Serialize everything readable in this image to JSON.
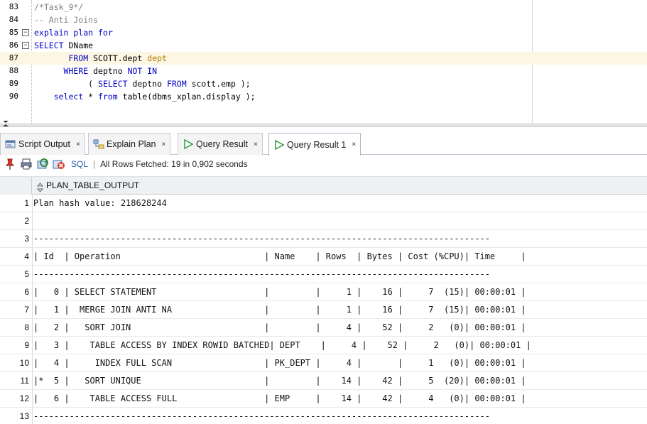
{
  "editor": {
    "lines": [
      {
        "num": "83",
        "fold": "",
        "segments": [
          {
            "t": "comment",
            "s": "/*Task_9*/"
          }
        ]
      },
      {
        "num": "84",
        "fold": "",
        "segments": [
          {
            "t": "comment",
            "s": "-- Anti Joins"
          }
        ]
      },
      {
        "num": "85",
        "fold": "⊟",
        "segments": [
          {
            "t": "keyword",
            "s": "explain plan for"
          }
        ]
      },
      {
        "num": "86",
        "fold": "⊟",
        "segments": [
          {
            "t": "keyword",
            "s": "SELECT"
          },
          {
            "t": "text",
            "s": " DName"
          }
        ]
      },
      {
        "num": "87",
        "fold": "",
        "current": true,
        "segments": [
          {
            "t": "text",
            "s": "       "
          },
          {
            "t": "keyword",
            "s": "FROM"
          },
          {
            "t": "text",
            "s": " SCOTT.dept "
          },
          {
            "t": "alias",
            "s": "dept"
          }
        ]
      },
      {
        "num": "88",
        "fold": "",
        "segments": [
          {
            "t": "text",
            "s": "      "
          },
          {
            "t": "keyword",
            "s": "WHERE"
          },
          {
            "t": "text",
            "s": " deptno "
          },
          {
            "t": "keyword",
            "s": "NOT IN"
          }
        ]
      },
      {
        "num": "89",
        "fold": "",
        "segments": [
          {
            "t": "text",
            "s": "           ( "
          },
          {
            "t": "keyword",
            "s": "SELECT"
          },
          {
            "t": "text",
            "s": " deptno "
          },
          {
            "t": "keyword",
            "s": "FROM"
          },
          {
            "t": "text",
            "s": " scott.emp );"
          }
        ]
      },
      {
        "num": "90",
        "fold": "",
        "segments": [
          {
            "t": "text",
            "s": "    "
          },
          {
            "t": "keyword",
            "s": "select"
          },
          {
            "t": "text",
            "s": " * "
          },
          {
            "t": "keyword",
            "s": "from"
          },
          {
            "t": "text",
            "s": " table(dbms_xplan.display );"
          }
        ]
      }
    ]
  },
  "tabs": [
    {
      "id": "script",
      "label": "Script Output",
      "close": "×"
    },
    {
      "id": "explain",
      "label": "Explain Plan",
      "close": "×"
    },
    {
      "id": "query",
      "label": "Query Result",
      "close": "×"
    },
    {
      "id": "query1",
      "label": "Query Result 1",
      "close": "×",
      "active": true
    }
  ],
  "toolbar": {
    "sql_label": "SQL",
    "separator": "|",
    "status": "All Rows Fetched: 19 in 0,902 seconds"
  },
  "grid": {
    "column": "PLAN_TABLE_OUTPUT",
    "rows": [
      {
        "num": "1",
        "value": "Plan hash value: 218628244"
      },
      {
        "num": "2",
        "value": ""
      },
      {
        "num": "3",
        "value": "-----------------------------------------------------------------------------------------"
      },
      {
        "num": "4",
        "value": "| Id  | Operation                            | Name    | Rows  | Bytes | Cost (%CPU)| Time     |"
      },
      {
        "num": "5",
        "value": "-----------------------------------------------------------------------------------------"
      },
      {
        "num": "6",
        "value": "|   0 | SELECT STATEMENT                     |         |     1 |    16 |     7  (15)| 00:00:01 |"
      },
      {
        "num": "7",
        "value": "|   1 |  MERGE JOIN ANTI NA                  |         |     1 |    16 |     7  (15)| 00:00:01 |"
      },
      {
        "num": "8",
        "value": "|   2 |   SORT JOIN                          |         |     4 |    52 |     2   (0)| 00:00:01 |"
      },
      {
        "num": "9",
        "value": "|   3 |    TABLE ACCESS BY INDEX ROWID BATCHED| DEPT    |     4 |    52 |     2   (0)| 00:00:01 |"
      },
      {
        "num": "10",
        "value": "|   4 |     INDEX FULL SCAN                  | PK_DEPT |     4 |       |     1   (0)| 00:00:01 |"
      },
      {
        "num": "11",
        "value": "|*  5 |   SORT UNIQUE                        |         |    14 |    42 |     5  (20)| 00:00:01 |"
      },
      {
        "num": "12",
        "value": "|   6 |    TABLE ACCESS FULL                 | EMP     |    14 |    42 |     4   (0)| 00:00:01 |"
      },
      {
        "num": "13",
        "value": "-----------------------------------------------------------------------------------------"
      }
    ]
  },
  "colors": {
    "keyword": "#0000c8",
    "comment": "#7f7f7f",
    "alias": "#b07d00",
    "current_line": "#fdf6e3"
  }
}
